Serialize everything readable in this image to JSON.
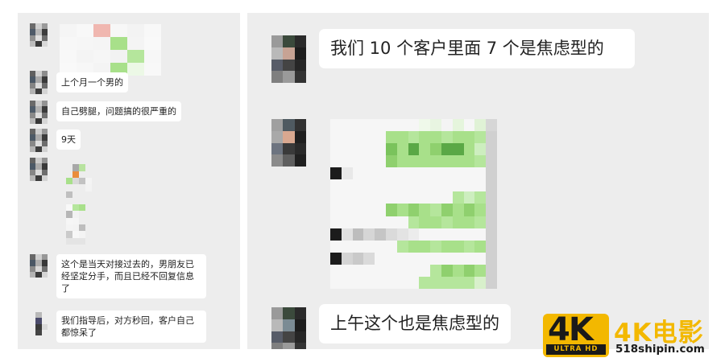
{
  "left_chat": {
    "messages": [
      {
        "text": "上个月一个男的"
      },
      {
        "text": "自己劈腿，问题搞的很严重的"
      },
      {
        "text": "9天"
      },
      {
        "text": "这个是当天对接过去的，男朋友已经坚定分手，而且已经不回复信息了"
      },
      {
        "text": "我们指导后，对方秒回，客户自己都惊呆了"
      }
    ]
  },
  "right_chat": {
    "messages": [
      {
        "text": "我们 10 个客户里面 7 个是焦虑型的"
      },
      {
        "text": "上午这个也是焦虑型的"
      }
    ]
  },
  "watermark": {
    "badge_text": "4K",
    "badge_subtext": "ULTRA HD",
    "brand": "4K电影",
    "url": "518shipin.com",
    "colors": {
      "badge": "#f3b800",
      "dark": "#1a1a1a"
    }
  },
  "colors": {
    "panel_bg": "#ededed",
    "bubble_bg": "#ffffff",
    "pixel_green_light": "#a8e08a",
    "pixel_green_dark": "#5aa846",
    "pixel_pink": "#f0b7b0"
  }
}
